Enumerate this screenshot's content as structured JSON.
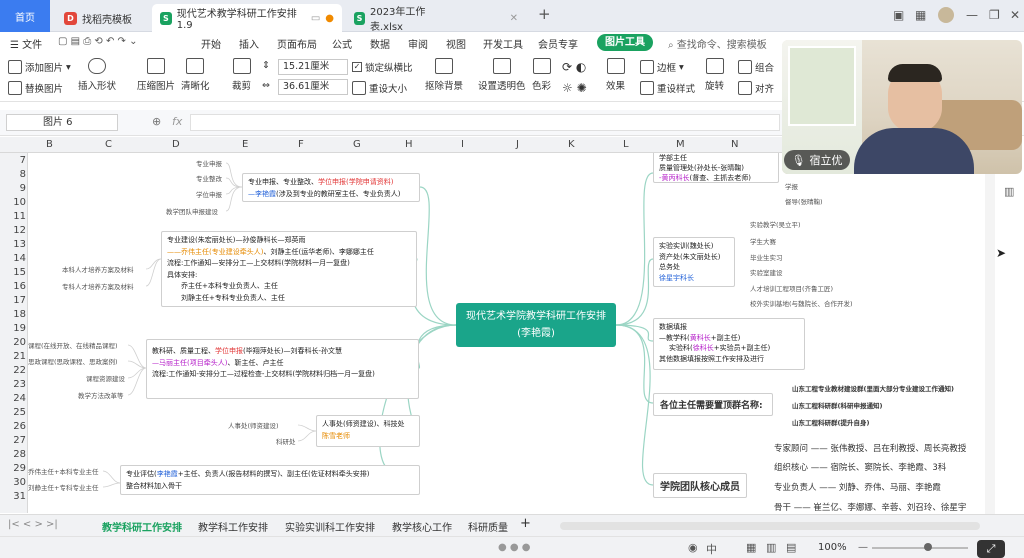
{
  "tabs": {
    "home": "首页",
    "tab1": "找稻壳模板",
    "tab2": "现代艺术教学科研工作安排1.9",
    "tab3": "2023年工作表.xlsx",
    "add": "+"
  },
  "menu": {
    "file": "文件",
    "items": [
      "开始",
      "插入",
      "页面布局",
      "公式",
      "数据",
      "审阅",
      "视图",
      "开发工具",
      "会员专享"
    ],
    "picture_tools": "图片工具",
    "search_placeholder": "查找命令、搜索模板"
  },
  "ribbon": {
    "add_picture": "添加图片",
    "replace_picture": "替换图片",
    "insert_shape": "插入形状",
    "compress": "压缩图片",
    "clarify": "清晰化",
    "crop": "裁剪",
    "height": "15.21厘米",
    "width": "36.61厘米",
    "lock_ratio": "锁定纵横比",
    "reset_size": "重设大小",
    "remove_bg": "抠除背景",
    "set_transparent": "设置透明色",
    "color": "色彩",
    "effect": "效果",
    "border": "边框",
    "reset_style": "重设样式",
    "rotate": "旋转",
    "group": "组合",
    "align": "对齐"
  },
  "formula_bar": {
    "name_box": "图片 6",
    "fx": "fx"
  },
  "columns": [
    "B",
    "C",
    "D",
    "E",
    "F",
    "G",
    "H",
    "I",
    "J",
    "K",
    "L",
    "M",
    "N"
  ],
  "rows": [
    "7",
    "8",
    "9",
    "10",
    "11",
    "12",
    "13",
    "14",
    "15",
    "16",
    "17",
    "18",
    "19",
    "20",
    "21",
    "22",
    "23",
    "24",
    "25",
    "26",
    "27",
    "28",
    "29",
    "30",
    "31"
  ],
  "mindmap": {
    "center_line1": "现代艺术学院教学科研工作安排",
    "center_line2": "(李艳霞)",
    "leaves_left": {
      "l1": "专业申报",
      "l2": "专业整改",
      "l3": "学位申报",
      "l4": "教学团队申报建设",
      "l5": "本科人才培养方案及材料",
      "l6": "专科人才培养方案及材料",
      "l7": "课程(在线开放、在线精品课程)",
      "l8": "思政课程(思政课程、思政案例)",
      "l9": "课程资源建设",
      "l10": "教学方法改革等",
      "l11": "人事处(师资建设)",
      "l12": "科研处",
      "l13": "乔伟主任+本科专业主任",
      "l14": "刘静主任+专科专业主任"
    },
    "n1_line1a": "专业申报、专业整改、",
    "n1_line1b": "学位申报",
    "n1_line1c": "(学院申请资料)",
    "n1_line2a": "—李艳霞",
    "n1_line2b": "(涉及到专业的教研室主任、专业负责人)",
    "n2_line1": "专业建设(朱宏丽处长)—孙俊静科长—郑英雨",
    "n2_line2a": "——乔伟主任",
    "n2_line2b": "(专业建设牵头人)",
    "n2_line2c": "、刘静主任(运华老师)、李娜娜主任",
    "n2_line3": "流程:工作通知—安排分工—上交材料(学院材料一月一复盘)",
    "n2_line4": "具体安排:",
    "n2_line5": "乔主任+本科专业负责人、主任",
    "n2_line6": "刘静主任+专科专业负责人、主任",
    "n3_line1a": "教科研、质量工程、",
    "n3_line1b": "学位申报",
    "n3_line1c": "(毕翔萍处长)—刘春科长-孙文慧",
    "n3_line2a": "—马丽主任",
    "n3_line2b": "(项目牵头人)",
    "n3_line2c": "、靳主任、卢主任",
    "n3_line3": "流程:工作通知-安排分工—过程检查-上交材料(学院材料归档一月一复盘)",
    "n4_line1": "人事处(师资建设)、科技处",
    "n4_line2": "陈雪老师",
    "n5_line1a": "专业评估(",
    "n5_line1b": "李艳霞",
    "n5_line1c": "+主任、负责人(报告材料的撰写)、副主任(佐证材料牵头安排)",
    "n5_line2": "整合材料加入骨干",
    "r1_line1": "学部主任",
    "r1_line2": "质量管理处(孙处长-张晴鞠)",
    "r1_line3": "-黄丙科长",
    "r1_line4": "(督查、主抓去老师)",
    "r1_leaf1": "学报",
    "r1_leaf2": "督导(张晴鞠)",
    "r2_line1": "实验实训(魏处长)",
    "r2_line2": "资产处(朱文丽处长)",
    "r2_line3": "总务处",
    "r2_line4": "徐星宇科长",
    "r2_leaves": [
      "实验教学(吴立平)",
      "学生大赛",
      "毕业生实习",
      "实验室建设",
      "人才培训工程项目(齐鲁工匠)",
      "校外实训基地(与魏院长、合作开发)"
    ],
    "r3_line1": "数据填报",
    "r3_line2a": "—教学科(",
    "r3_line2b": "黄科长",
    "r3_line2c": "+副主任)",
    "r3_line3a": "实验科(",
    "r3_line3b": "徐科长",
    "r3_line3c": "+实验员+副主任)",
    "r3_line4": "其他数据填报按照工作安排及进行",
    "r4": "各位主任需要置顶群名称:",
    "r4_items": [
      "山东工程专业教材建设群(里面大部分专业建设工作通知)",
      "山东工程科研群(科研申报通知)",
      "山东工程科研群(提升自身)"
    ],
    "r5": "学院团队核心成员",
    "r5_items": [
      "专家顾问 —— 张伟教授、吕在利教授、周长亮教授",
      "组织核心 —— 宿院长、窦院长、李艳霞、3科",
      "专业负责人 —— 刘静、乔伟、马丽、李艳霞",
      "骨干 —— 崔兰亿、李娜娜、辛蓉、刘召玲、徐星宇"
    ]
  },
  "sheet_tabs": [
    "教学科研工作安排",
    "教学科工作安排",
    "实验实训科工作安排",
    "教学核心工作",
    "科研质量"
  ],
  "status": {
    "zoom": "100%"
  },
  "video": {
    "name": "宿立优"
  }
}
